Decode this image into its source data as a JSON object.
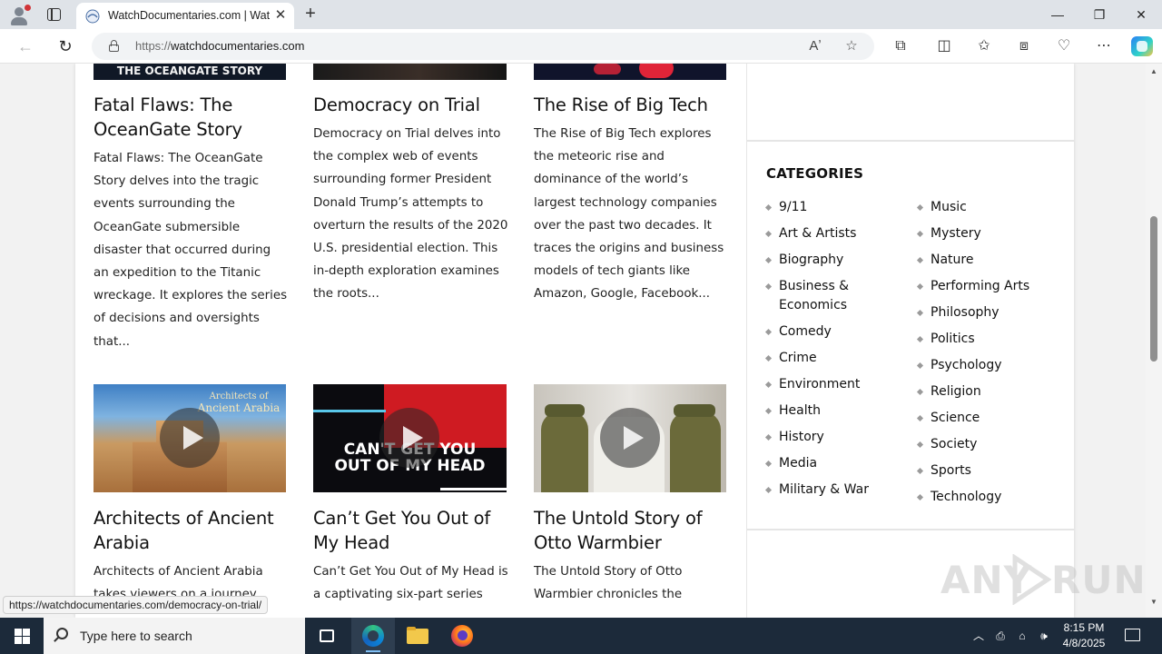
{
  "browser": {
    "tab_title": "WatchDocumentaries.com | Watch",
    "url_scheme": "https://",
    "url_host": "watchdocumentaries.com",
    "new_tab_symbol": "+",
    "window_controls": {
      "minimize": "—",
      "maximize": "❐",
      "close": "✕"
    }
  },
  "articles_top": [
    {
      "title": "Fatal Flaws: The OceanGate Story",
      "thumb_caption": "THE OCEANGATE STORY",
      "description": "Fatal Flaws: The OceanGate Story delves into the tragic events surrounding the OceanGate submersible disaster that occurred during an expedition to the Titanic wreckage. It explores the series of decisions and oversights that..."
    },
    {
      "title": "Democracy on Trial",
      "thumb_caption": "",
      "description": "Democracy on Trial delves into the complex web of events surrounding former President Donald Trump’s attempts to overturn the results of the 2020 U.S. presidential election. This in-depth exploration examines the roots..."
    },
    {
      "title": "The Rise of Big Tech",
      "thumb_caption": "",
      "description": "The Rise of Big Tech explores the meteoric rise and dominance of the world’s largest technology companies over the past two decades. It traces the origins and business models of tech giants like Amazon, Google, Facebook..."
    }
  ],
  "articles_bottom": [
    {
      "title": "Architects of Ancient Arabia",
      "thumb_caption_1": "Architects of",
      "thumb_caption_2": "Ancient Arabia",
      "description": "Architects of Ancient Arabia takes viewers on a journey"
    },
    {
      "title": "Can’t Get You Out of My Head",
      "thumb_caption_1": "CAN'T GET YOU",
      "thumb_caption_2": "OUT OF MY HEAD",
      "description": "Can’t Get You Out of My Head is a captivating six-part series"
    },
    {
      "title": "The Untold Story of Otto Warmbier",
      "description": "The Untold Story of Otto Warmbier chronicles the"
    }
  ],
  "sidebar": {
    "categories_heading": "CATEGORIES",
    "col1": [
      "9/11",
      "Art & Artists",
      "Biography",
      "Business & Economics",
      "Comedy",
      "Crime",
      "Environment",
      "Health",
      "History",
      "Media",
      "Military & War"
    ],
    "col2": [
      "Music",
      "Mystery",
      "Nature",
      "Performing Arts",
      "Philosophy",
      "Politics",
      "Psychology",
      "Religion",
      "Science",
      "Society",
      "Sports",
      "Technology"
    ]
  },
  "status_bar_url": "https://watchdocumentaries.com/democracy-on-trial/",
  "watermark": {
    "left": "ANY",
    "right": "RUN"
  },
  "taskbar": {
    "search_placeholder": "Type here to search",
    "time": "8:15 PM",
    "date": "4/8/2025"
  },
  "colors": {
    "taskbar": "#1c2a3a",
    "accent": "#0078d4"
  }
}
